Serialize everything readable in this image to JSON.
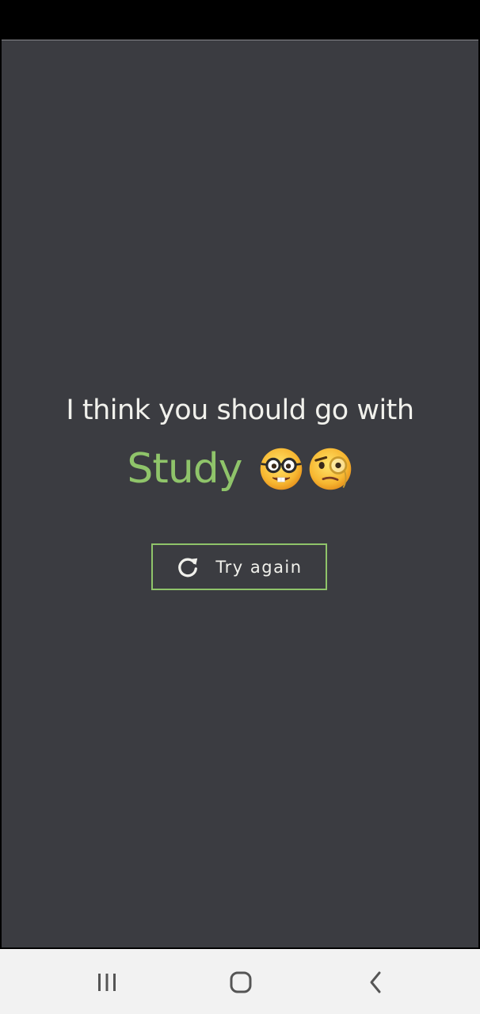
{
  "result": {
    "lead_text": "I think you should go with",
    "answer": "Study",
    "emojis": [
      "nerd-face-emoji",
      "face-with-monocle-emoji"
    ]
  },
  "actions": {
    "try_again_label": "Try again",
    "try_again_icon": "refresh-icon"
  },
  "navigation": {
    "buttons": [
      "recent-apps",
      "home",
      "back"
    ]
  },
  "colors": {
    "background": "#3b3c41",
    "accent": "#8fc46a",
    "text": "#f1f1ec"
  }
}
